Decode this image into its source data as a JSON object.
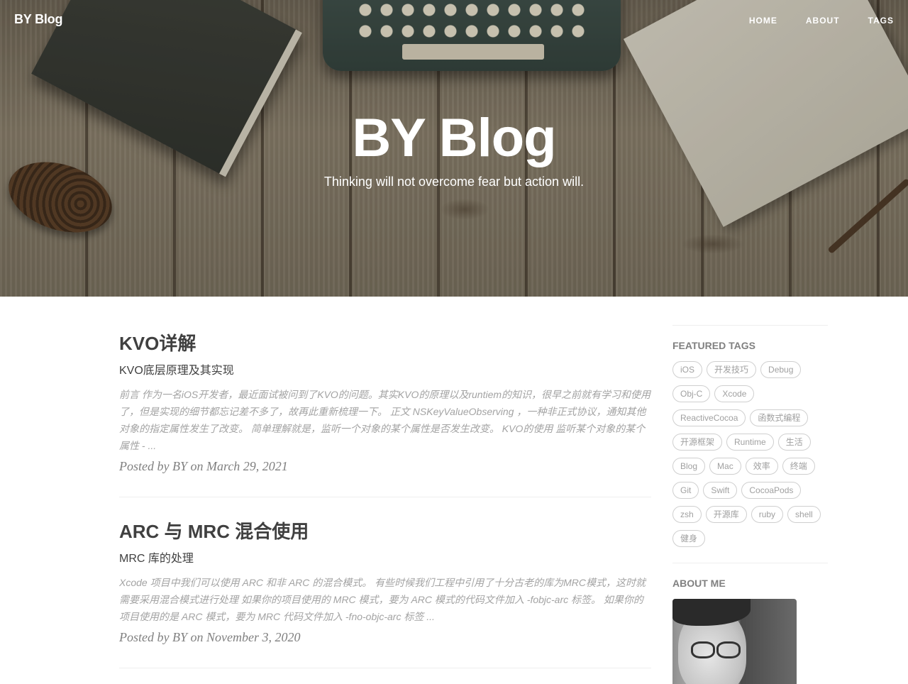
{
  "nav": {
    "brand": "BY Blog",
    "items": [
      "HOME",
      "ABOUT",
      "TAGS"
    ]
  },
  "hero": {
    "title": "BY Blog",
    "subtitle": "Thinking will not overcome fear but action will."
  },
  "posts": [
    {
      "title": "KVO详解",
      "subtitle": "KVO底层原理及其实现",
      "excerpt": "前言 作为一名iOS开发者，最近面试被问到了KVO的问题。其实KVO的原理以及runtiem的知识，很早之前就有学习和使用了，但是实现的细节都忘记差不多了，故再此重新梳理一下。 正文 NSKeyValueObserving ，一种非正式协议，通知其他对象的指定属性发生了改变。 简单理解就是，监听一个对象的某个属性是否发生改变。 KVO的使用 监听某个对象的某个属性 - ...",
      "meta": "Posted by BY on March 29, 2021"
    },
    {
      "title": "ARC 与 MRC 混合使用",
      "subtitle": "MRC 库的处理",
      "excerpt": "Xcode 项目中我们可以使用 ARC 和非 ARC 的混合模式。 有些时候我们工程中引用了十分古老的库为MRC模式，这时就需要采用混合模式进行处理 如果你的项目使用的 MRC 模式，要为 ARC 模式的代码文件加入 -fobjc-arc 标签。 如果你的项目使用的是 ARC 模式，要为 MRC 代码文件加入 -fno-objc-arc 标签 ...",
      "meta": "Posted by BY on November 3, 2020"
    }
  ],
  "sidebar": {
    "featured_tags_heading": "FEATURED TAGS",
    "tags": [
      "iOS",
      "开发技巧",
      "Debug",
      "Obj-C",
      "Xcode",
      "ReactiveCocoa",
      "函数式编程",
      "开源框架",
      "Runtime",
      "生活",
      "Blog",
      "Mac",
      "效率",
      "终端",
      "Git",
      "Swift",
      "CocoaPods",
      "zsh",
      "开源库",
      "ruby",
      "shell",
      "健身"
    ],
    "about_heading": "ABOUT ME"
  }
}
